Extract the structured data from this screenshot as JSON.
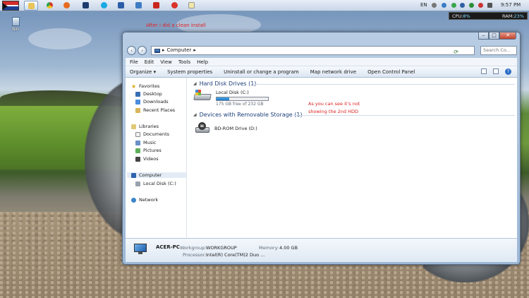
{
  "taskbar": {
    "language": "EN",
    "clock": "9:57 PM",
    "programs": [
      "explorer",
      "chrome",
      "firefox",
      "photoshop",
      "skype",
      "word",
      "virtualbox",
      "pdf-reader",
      "stop",
      "notepad"
    ]
  },
  "sysmon": {
    "cpu_label": "CPU:",
    "cpu_value": "8%",
    "ram_label": "RAM:",
    "ram_value": "23%"
  },
  "desktop": {
    "icon_label": "Bin",
    "annotation_top": "After i did a clean install",
    "annotation_mid_line1": "As you can see it's not",
    "annotation_mid_line2": "showing the 2nd HDD"
  },
  "window": {
    "caption": {
      "minimize": "–",
      "maximize": "□",
      "close": "✕"
    },
    "address": {
      "text": "Computer",
      "separator": "▸"
    },
    "search_placeholder": "Search Co...",
    "menu": [
      "File",
      "Edit",
      "View",
      "Tools",
      "Help"
    ],
    "commands": {
      "organize": "Organize ▾",
      "system_properties": "System properties",
      "uninstall": "Uninstall or change a program",
      "map_drive": "Map network drive",
      "control_panel": "Open Control Panel"
    },
    "nav": {
      "favorites": "Favorites",
      "desktop": "Desktop",
      "downloads": "Downloads",
      "recent": "Recent Places",
      "libraries": "Libraries",
      "documents": "Documents",
      "music": "Music",
      "pictures": "Pictures",
      "videos": "Videos",
      "computer": "Computer",
      "local_disk": "Local Disk (C:)",
      "network": "Network"
    },
    "groups": {
      "hdd": "Hard Disk Drives (1)",
      "removable": "Devices with Removable Storage (1)"
    },
    "drives": {
      "c_name": "Local Disk (C:)",
      "c_free": "175 GB free of 232 GB",
      "c_used_fraction": 0.25,
      "bd_name": "BD-ROM Drive (D:)",
      "bd_disc_label": "BD"
    },
    "details": {
      "pc_name": "ACER-PC",
      "workgroup_label": "Workgroup:",
      "workgroup_value": "WORKGROUP",
      "memory_label": "Memory:",
      "memory_value": "4.00 GB",
      "processor_label": "Processor:",
      "processor_value": "Intel(R) Core(TM)2 Duo ..."
    }
  },
  "colors": {
    "annotation": "#dd2222",
    "accent": "#1e3f7a",
    "progress": "#1c77c5"
  }
}
